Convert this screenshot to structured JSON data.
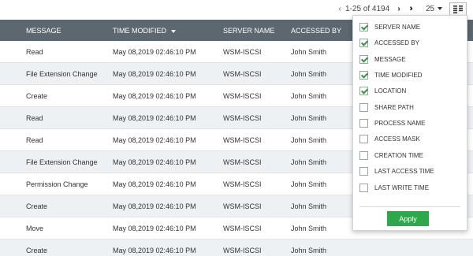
{
  "pagination": {
    "prev_icon": "chevron-left-icon",
    "range": "1-25 of 4194",
    "next_icon": "chevron-right-icon",
    "last_icon": "double-chevron-right-icon",
    "page_size": "25"
  },
  "column_toggle_icon": "columns-icon",
  "table": {
    "columns": [
      "MESSAGE",
      "TIME MODIFIED",
      "SERVER NAME",
      "ACCESSED BY"
    ],
    "sorted_column": "TIME MODIFIED",
    "rows": [
      [
        "Read",
        "May 08,2019 02:46:10 PM",
        "WSM-ISCSI",
        "John Smith"
      ],
      [
        "File Extension Change",
        "May 08,2019 02:46:10 PM",
        "WSM-ISCSI",
        "John Smith"
      ],
      [
        "Create",
        "May 08,2019 02:46:10 PM",
        "WSM-ISCSI",
        "John Smith"
      ],
      [
        "Read",
        "May 08,2019 02:46:10 PM",
        "WSM-ISCSI",
        "John Smith"
      ],
      [
        "Read",
        "May 08,2019 02:46:10 PM",
        "WSM-ISCSI",
        "John Smith"
      ],
      [
        "File Extension Change",
        "May 08,2019 02:46:10 PM",
        "WSM-ISCSI",
        "John Smith"
      ],
      [
        "Permission Change",
        "May 08,2019 02:46:10 PM",
        "WSM-ISCSI",
        "John Smith"
      ],
      [
        "Create",
        "May 08,2019 02:46:10 PM",
        "WSM-ISCSI",
        "John Smith"
      ],
      [
        "Move",
        "May 08,2019 02:46:10 PM",
        "WSM-ISCSI",
        "John Smith"
      ],
      [
        "Create",
        "May 08,2019 02:46:10 PM",
        "WSM-ISCSI",
        "John Smith"
      ]
    ]
  },
  "column_chooser": {
    "options": [
      {
        "label": "SERVER NAME",
        "checked": true
      },
      {
        "label": "ACCESSED BY",
        "checked": true
      },
      {
        "label": "MESSAGE",
        "checked": true
      },
      {
        "label": "TIME MODIFIED",
        "checked": true
      },
      {
        "label": "LOCATION",
        "checked": true
      },
      {
        "label": "SHARE PATH",
        "checked": false
      },
      {
        "label": "PROCESS NAME",
        "checked": false
      },
      {
        "label": "ACCESS MASK",
        "checked": false
      },
      {
        "label": "CREATION TIME",
        "checked": false
      },
      {
        "label": "LAST ACCESS TIME",
        "checked": false
      },
      {
        "label": "LAST WRITE TIME",
        "checked": false
      }
    ],
    "apply_label": "Apply"
  },
  "colors": {
    "header_bg": "#5c6770",
    "row_alt_bg": "#eef1f4",
    "check_green": "#2e9c3d",
    "apply_green": "#2ea84a"
  }
}
